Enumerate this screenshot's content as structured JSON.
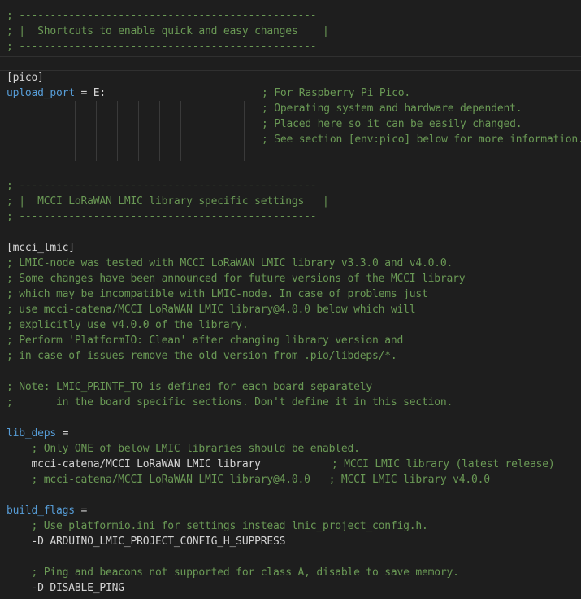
{
  "colors": {
    "background": "#1e1e1e",
    "comment": "#6a9955",
    "key": "#569cd6",
    "text": "#d4d4d4"
  },
  "lines": [
    {
      "type": "comment",
      "text": "; ------------------------------------------------"
    },
    {
      "type": "comment",
      "text": "; |  Shortcuts to enable quick and easy changes    |"
    },
    {
      "type": "comment",
      "text": "; ------------------------------------------------"
    },
    {
      "type": "blank",
      "text": ""
    },
    {
      "type": "section",
      "text": "[pico]"
    },
    {
      "type": "keyvalue",
      "key": "upload_port",
      "value": " = E:",
      "comment": "; For Raspberry Pi Pico."
    },
    {
      "type": "indented-comment",
      "text": "; Operating system and hardware dependent."
    },
    {
      "type": "indented-comment",
      "text": "; Placed here so it can be easily changed."
    },
    {
      "type": "indented-comment",
      "text": "; See section [env:pico] below for more information."
    },
    {
      "type": "blank",
      "text": ""
    },
    {
      "type": "blank",
      "text": ""
    },
    {
      "type": "comment",
      "text": "; ------------------------------------------------"
    },
    {
      "type": "comment",
      "text": "; |  MCCI LoRaWAN LMIC library specific settings   |"
    },
    {
      "type": "comment",
      "text": "; ------------------------------------------------"
    },
    {
      "type": "blank",
      "text": ""
    },
    {
      "type": "section",
      "text": "[mcci_lmic]"
    },
    {
      "type": "comment",
      "text": "; LMIC-node was tested with MCCI LoRaWAN LMIC library v3.3.0 and v4.0.0."
    },
    {
      "type": "comment",
      "text": "; Some changes have been announced for future versions of the MCCI library"
    },
    {
      "type": "comment",
      "text": "; which may be incompatible with LMIC-node. In case of problems just"
    },
    {
      "type": "comment",
      "text": "; use mcci-catena/MCCI LoRaWAN LMIC library@4.0.0 below which will"
    },
    {
      "type": "comment",
      "text": "; explicitly use v4.0.0 of the library."
    },
    {
      "type": "comment",
      "text": "; Perform 'PlatformIO: Clean' after changing library version and"
    },
    {
      "type": "comment",
      "text": "; in case of issues remove the old version from .pio/libdeps/*."
    },
    {
      "type": "blank",
      "text": ""
    },
    {
      "type": "comment",
      "text": "; Note: LMIC_PRINTF_TO is defined for each board separately"
    },
    {
      "type": "comment",
      "text": ";       in the board specific sections. Don't define it in this section."
    },
    {
      "type": "blank",
      "text": ""
    },
    {
      "type": "keyvalue",
      "key": "lib_deps",
      "value": " =",
      "comment": ""
    },
    {
      "type": "comment",
      "text": "    ; Only ONE of below LMIC libraries should be enabled."
    },
    {
      "type": "value-comment",
      "value": "    mcci-catena/MCCI LoRaWAN LMIC library           ",
      "comment": "; MCCI LMIC library (latest release)"
    },
    {
      "type": "comment",
      "text": "    ; mcci-catena/MCCI LoRaWAN LMIC library@4.0.0   ; MCCI LMIC library v4.0.0"
    },
    {
      "type": "blank",
      "text": ""
    },
    {
      "type": "keyvalue",
      "key": "build_flags",
      "value": " =",
      "comment": ""
    },
    {
      "type": "comment",
      "text": "    ; Use platformio.ini for settings instead lmic_project_config.h."
    },
    {
      "type": "plain",
      "text": "    -D ARDUINO_LMIC_PROJECT_CONFIG_H_SUPPRESS"
    },
    {
      "type": "blank",
      "text": ""
    },
    {
      "type": "comment",
      "text": "    ; Ping and beacons not supported for class A, disable to save memory."
    },
    {
      "type": "plain",
      "text": "    -D DISABLE_PING"
    }
  ]
}
